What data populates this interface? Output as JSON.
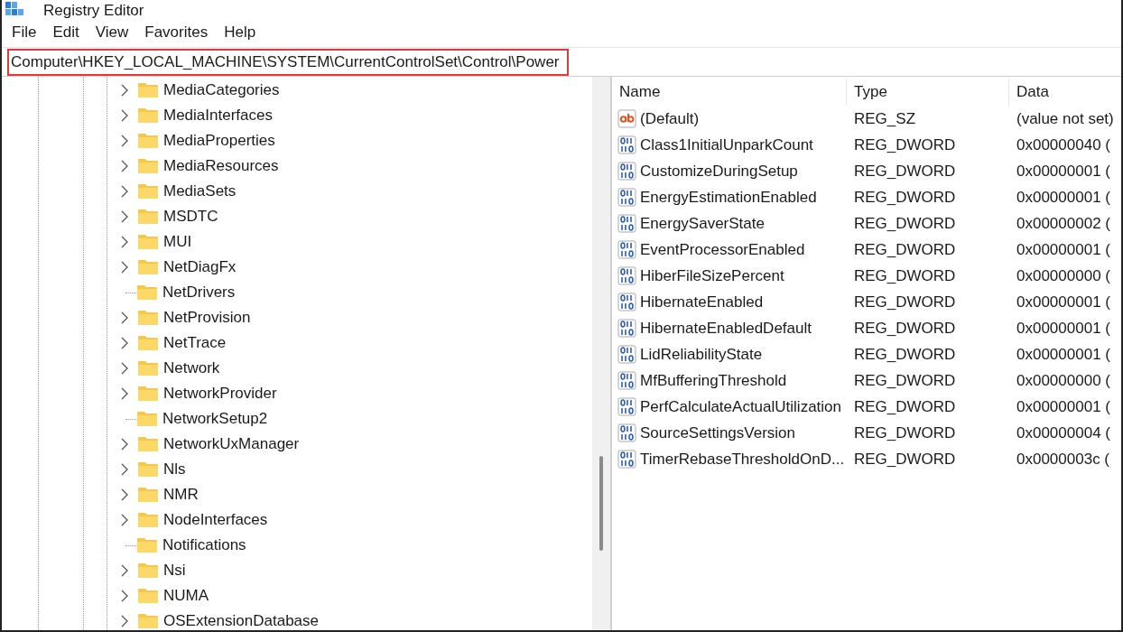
{
  "window": {
    "title": "Registry Editor"
  },
  "menu": [
    "File",
    "Edit",
    "View",
    "Favorites",
    "Help"
  ],
  "address_bar": {
    "value": "Computer\\HKEY_LOCAL_MACHINE\\SYSTEM\\CurrentControlSet\\Control\\Power",
    "highlighted": true
  },
  "tree": {
    "items": [
      {
        "label": "MediaCategories",
        "has_children": true
      },
      {
        "label": "MediaInterfaces",
        "has_children": true
      },
      {
        "label": "MediaProperties",
        "has_children": true
      },
      {
        "label": "MediaResources",
        "has_children": true
      },
      {
        "label": "MediaSets",
        "has_children": true
      },
      {
        "label": "MSDTC",
        "has_children": true
      },
      {
        "label": "MUI",
        "has_children": true
      },
      {
        "label": "NetDiagFx",
        "has_children": true
      },
      {
        "label": "NetDrivers",
        "has_children": false
      },
      {
        "label": "NetProvision",
        "has_children": true
      },
      {
        "label": "NetTrace",
        "has_children": true
      },
      {
        "label": "Network",
        "has_children": true
      },
      {
        "label": "NetworkProvider",
        "has_children": true
      },
      {
        "label": "NetworkSetup2",
        "has_children": false
      },
      {
        "label": "NetworkUxManager",
        "has_children": true
      },
      {
        "label": "Nls",
        "has_children": true
      },
      {
        "label": "NMR",
        "has_children": true
      },
      {
        "label": "NodeInterfaces",
        "has_children": true
      },
      {
        "label": "Notifications",
        "has_children": false
      },
      {
        "label": "Nsi",
        "has_children": true
      },
      {
        "label": "NUMA",
        "has_children": true
      },
      {
        "label": "OSExtensionDatabase",
        "has_children": true
      }
    ]
  },
  "values": {
    "columns": [
      "Name",
      "Type",
      "Data"
    ],
    "rows": [
      {
        "kind": "string",
        "name": "(Default)",
        "type": "REG_SZ",
        "data": "(value not set)"
      },
      {
        "kind": "binary",
        "name": "Class1InitialUnparkCount",
        "type": "REG_DWORD",
        "data": "0x00000040 ("
      },
      {
        "kind": "binary",
        "name": "CustomizeDuringSetup",
        "type": "REG_DWORD",
        "data": "0x00000001 ("
      },
      {
        "kind": "binary",
        "name": "EnergyEstimationEnabled",
        "type": "REG_DWORD",
        "data": "0x00000001 ("
      },
      {
        "kind": "binary",
        "name": "EnergySaverState",
        "type": "REG_DWORD",
        "data": "0x00000002 ("
      },
      {
        "kind": "binary",
        "name": "EventProcessorEnabled",
        "type": "REG_DWORD",
        "data": "0x00000001 ("
      },
      {
        "kind": "binary",
        "name": "HiberFileSizePercent",
        "type": "REG_DWORD",
        "data": "0x00000000 ("
      },
      {
        "kind": "binary",
        "name": "HibernateEnabled",
        "type": "REG_DWORD",
        "data": "0x00000001 ("
      },
      {
        "kind": "binary",
        "name": "HibernateEnabledDefault",
        "type": "REG_DWORD",
        "data": "0x00000001 ("
      },
      {
        "kind": "binary",
        "name": "LidReliabilityState",
        "type": "REG_DWORD",
        "data": "0x00000001 ("
      },
      {
        "kind": "binary",
        "name": "MfBufferingThreshold",
        "type": "REG_DWORD",
        "data": "0x00000000 ("
      },
      {
        "kind": "binary",
        "name": "PerfCalculateActualUtilization",
        "type": "REG_DWORD",
        "data": "0x00000001 ("
      },
      {
        "kind": "binary",
        "name": "SourceSettingsVersion",
        "type": "REG_DWORD",
        "data": "0x00000004 ("
      },
      {
        "kind": "binary",
        "name": "TimerRebaseThresholdOnD...",
        "type": "REG_DWORD",
        "data": "0x0000003c ("
      }
    ]
  }
}
